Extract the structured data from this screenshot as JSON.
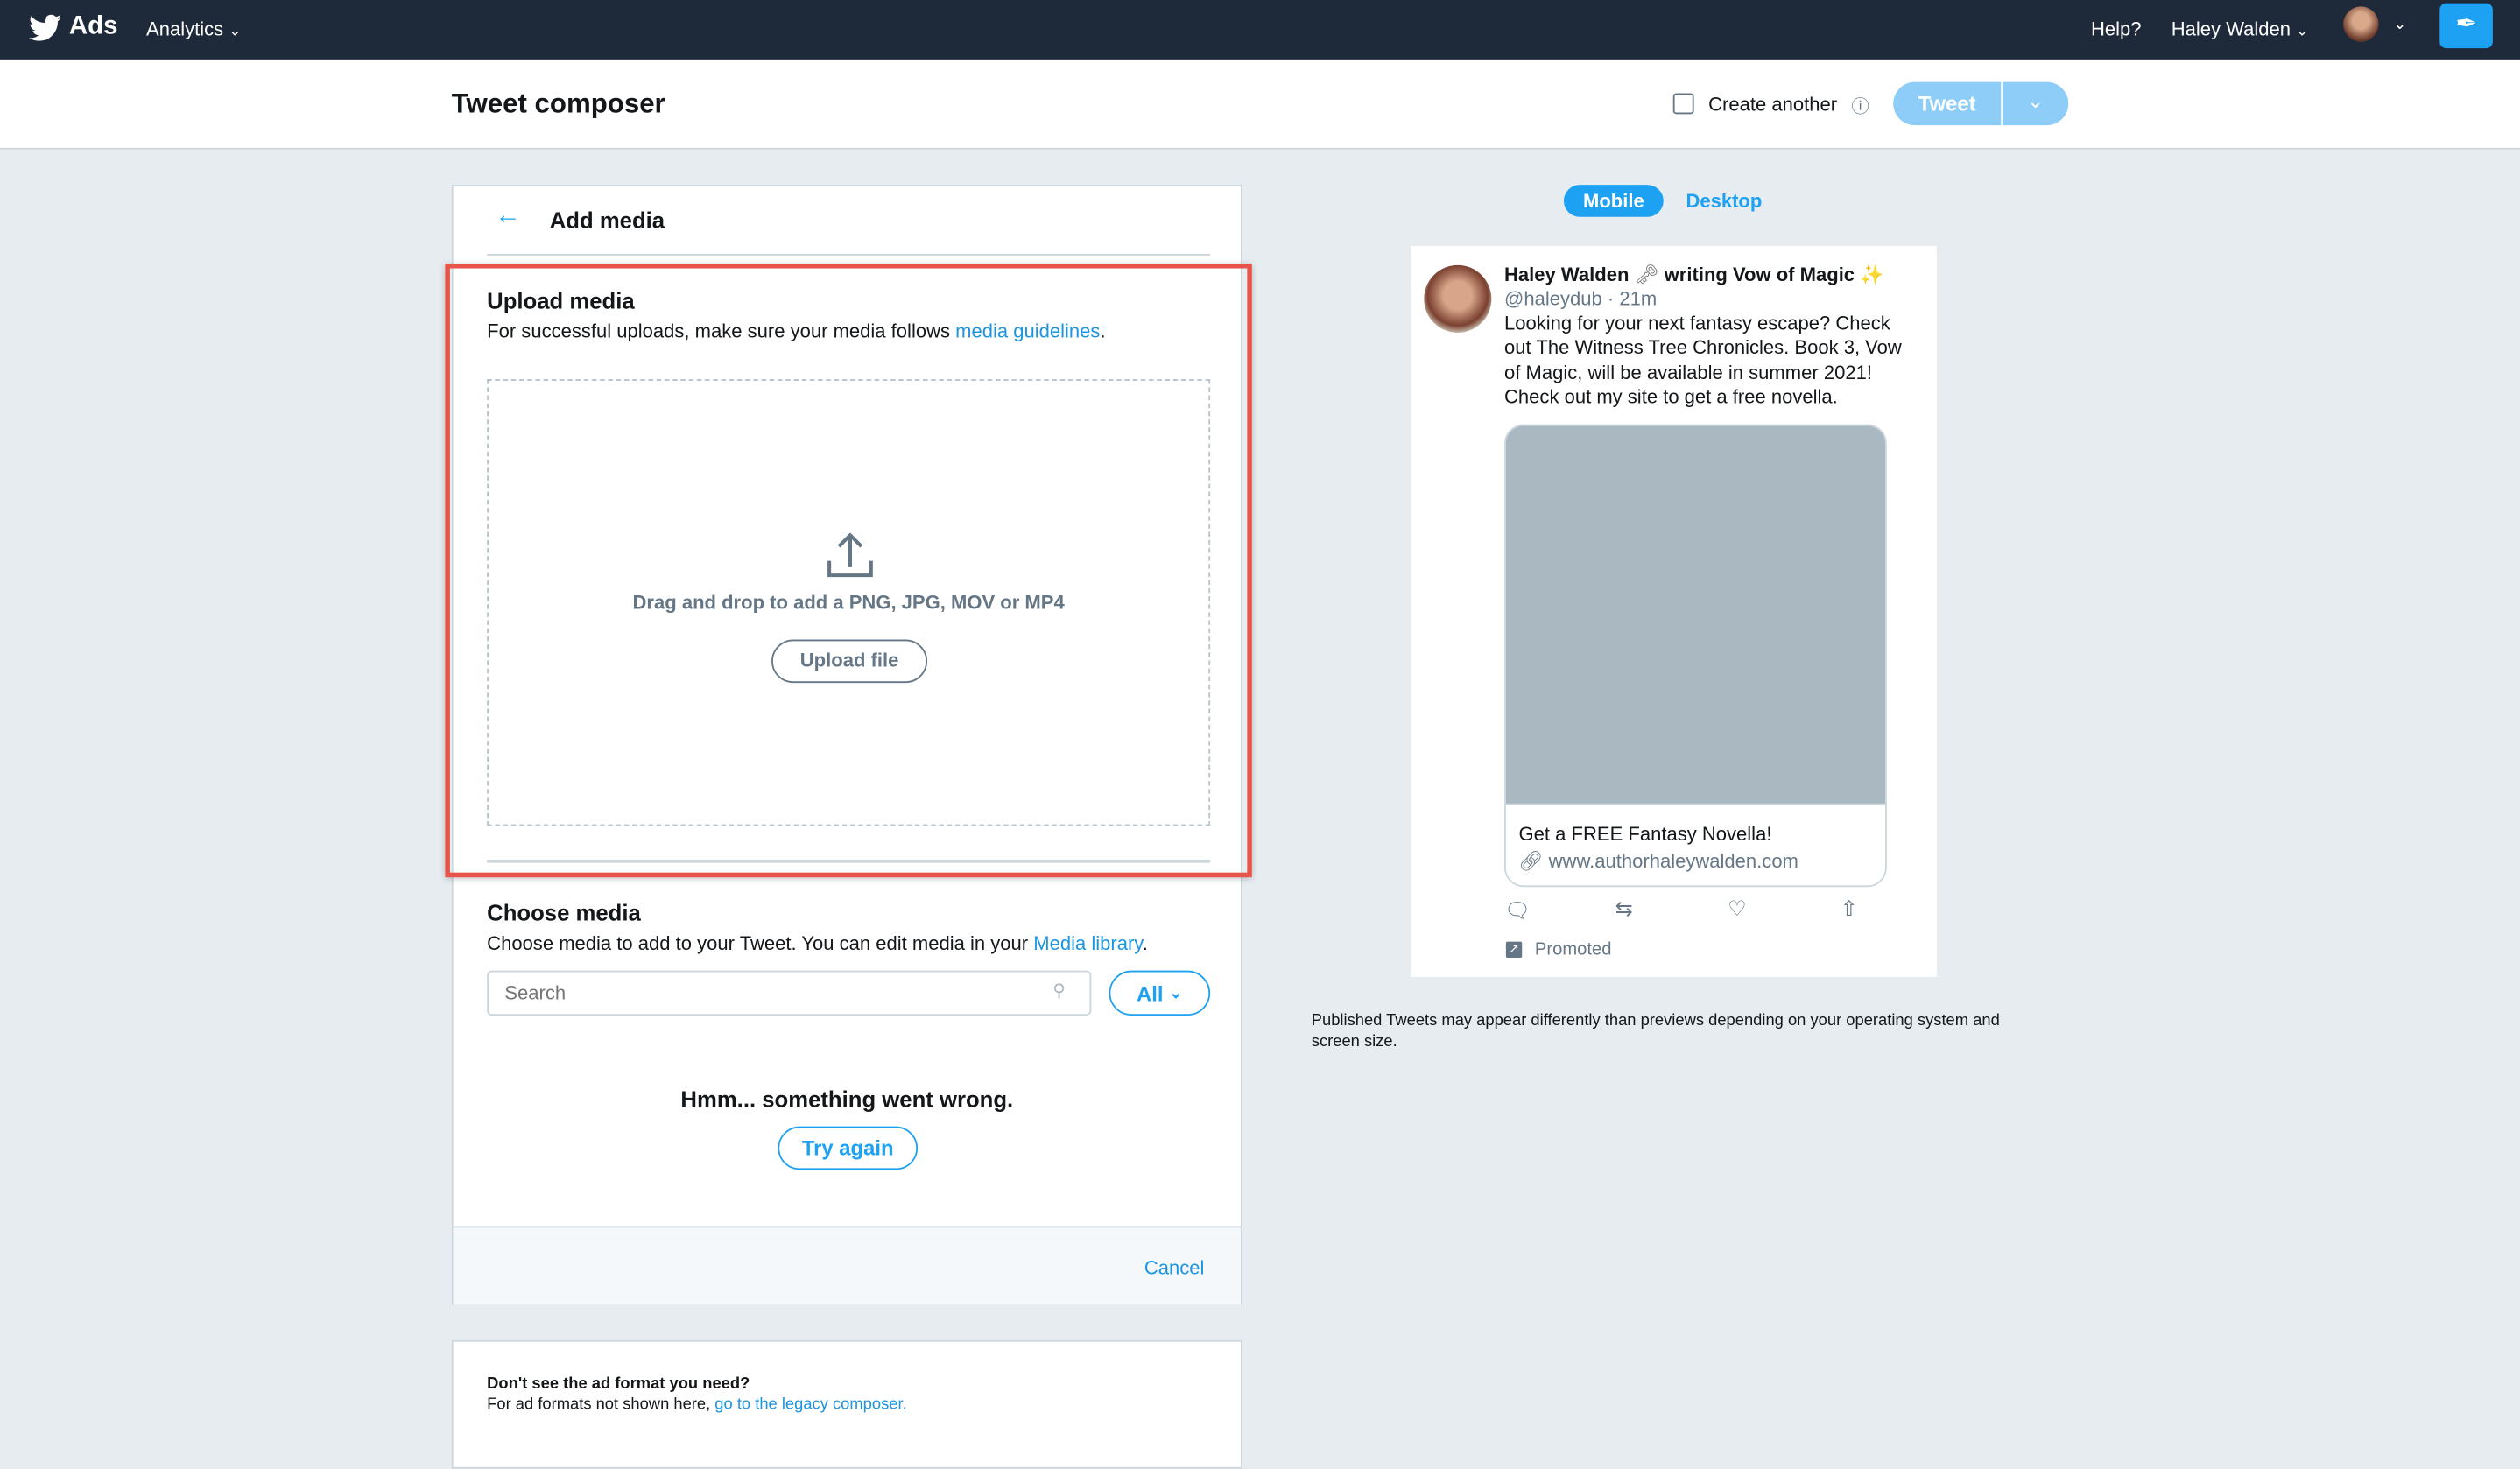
{
  "topbar": {
    "brand": "Ads",
    "analytics": "Analytics",
    "help": "Help?",
    "user": "Haley Walden"
  },
  "header": {
    "title": "Tweet composer",
    "create_another": "Create another",
    "tweet": "Tweet"
  },
  "add_media": {
    "title": "Add media",
    "upload": {
      "title": "Upload media",
      "desc": "For successful uploads, make sure your media follows ",
      "desc_link": "media guidelines",
      "desc_end": ".",
      "drop_text": "Drag and drop to add a PNG, JPG, MOV or MP4",
      "button": "Upload file"
    },
    "choose": {
      "title": "Choose media",
      "desc": "Choose media to add to your Tweet. You can edit media in your ",
      "desc_link": "Media library",
      "desc_end": ".",
      "search_placeholder": "Search",
      "filter": "All",
      "error": "Hmm... something went wrong.",
      "retry": "Try again"
    },
    "cancel": "Cancel"
  },
  "legacy": {
    "title": "Don't see the ad format you need?",
    "desc": "For ad formats not shown here, ",
    "link": "go to the legacy composer."
  },
  "preview": {
    "tabs": [
      "Mobile",
      "Desktop"
    ],
    "name": "Haley Walden",
    "name_suffix": "writing Vow of Magic",
    "handle": "@haleydub · 21m",
    "text": "Looking for your next fantasy escape? Check out The Witness Tree Chronicles. Book 3, Vow of Magic, will be available in summer 2021! Check out my site to get a free novella.",
    "card_title": "Get a FREE Fantasy Novella!",
    "card_url": "www.authorhaleywalden.com",
    "promoted": "Promoted",
    "disclaimer": "Published Tweets may appear differently than previews depending on your operating system and screen size."
  },
  "colors": {
    "accent": "#1da1f2",
    "highlight": "#e8544a",
    "navbar": "#1e2a3a"
  }
}
